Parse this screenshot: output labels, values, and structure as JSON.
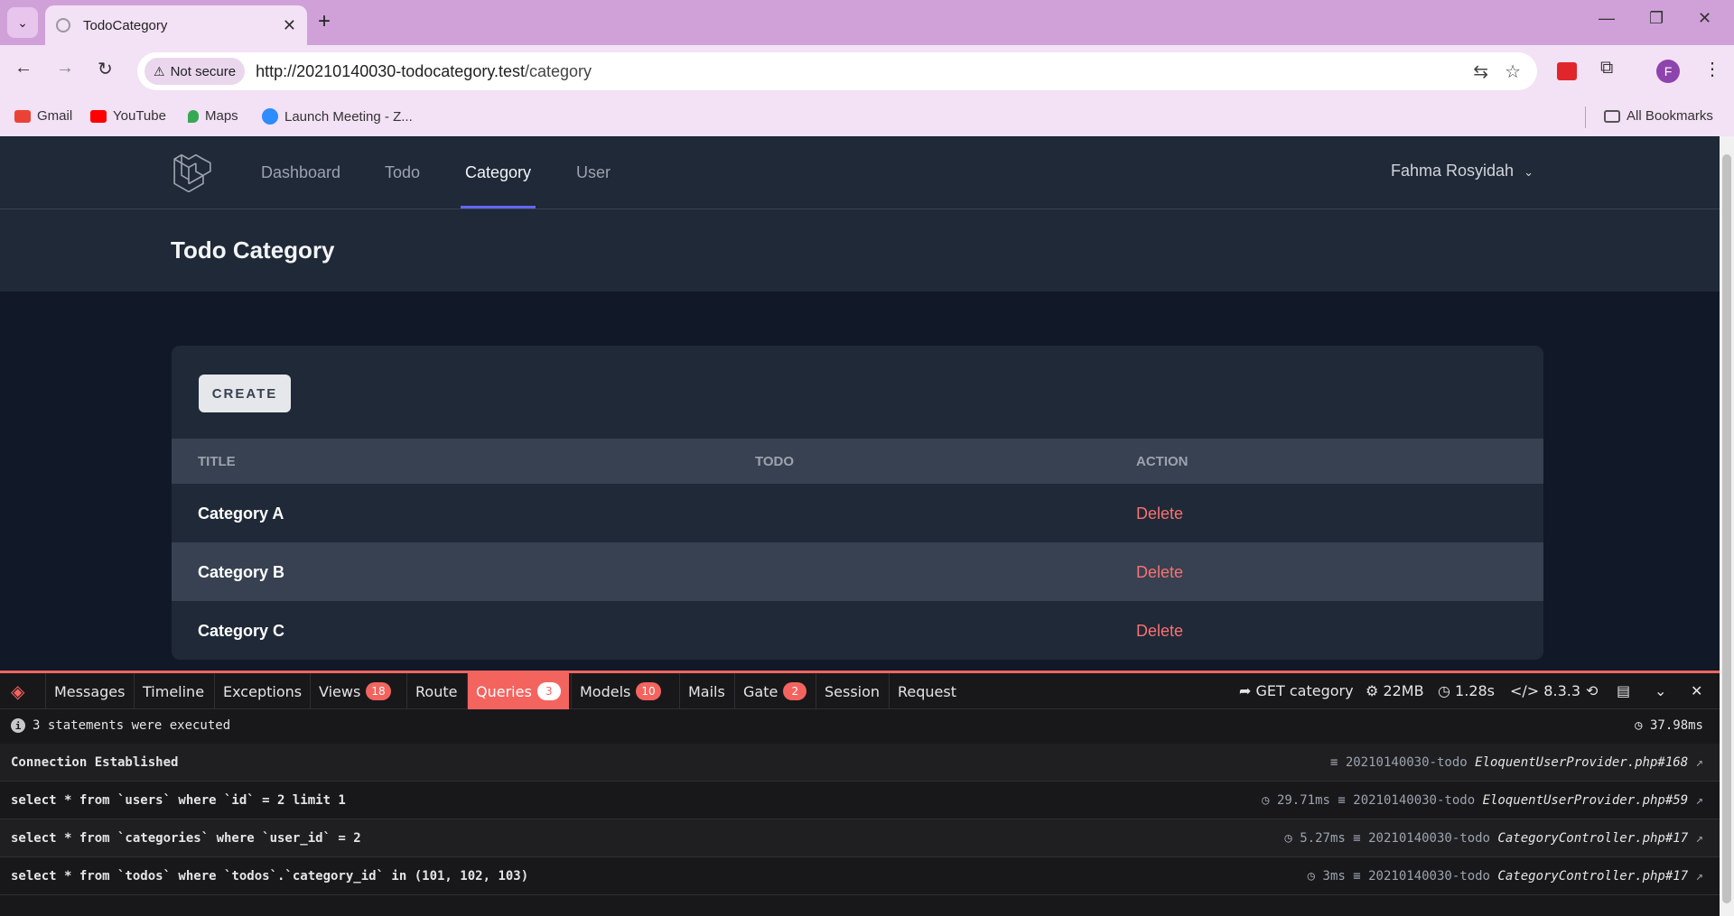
{
  "browser": {
    "tab_title": "TodoCategory",
    "security_label": "Not secure",
    "url_host": "http://20210140030-todocategory.test",
    "url_path": "/category",
    "profile_initial": "F",
    "bookmarks": [
      "Gmail",
      "YouTube",
      "Maps",
      "Launch Meeting - Z..."
    ],
    "all_bookmarks_label": "All Bookmarks"
  },
  "app": {
    "nav": [
      "Dashboard",
      "Todo",
      "Category",
      "User"
    ],
    "active_nav": "Category",
    "user_name": "Fahma Rosyidah",
    "page_title": "Todo Category",
    "create_label": "CREATE",
    "table": {
      "headers": [
        "TITLE",
        "TODO",
        "ACTION"
      ],
      "rows": [
        {
          "title": "Category A",
          "todo": "",
          "action": "Delete"
        },
        {
          "title": "Category B",
          "todo": "",
          "action": "Delete"
        },
        {
          "title": "Category C",
          "todo": "",
          "action": "Delete"
        }
      ]
    }
  },
  "debugbar": {
    "tabs": [
      {
        "label": "Messages",
        "badge": ""
      },
      {
        "label": "Timeline",
        "badge": ""
      },
      {
        "label": "Exceptions",
        "badge": ""
      },
      {
        "label": "Views",
        "badge": "18"
      },
      {
        "label": "Route",
        "badge": ""
      },
      {
        "label": "Queries",
        "badge": "3"
      },
      {
        "label": "Models",
        "badge": "10"
      },
      {
        "label": "Mails",
        "badge": ""
      },
      {
        "label": "Gate",
        "badge": "2"
      },
      {
        "label": "Session",
        "badge": ""
      },
      {
        "label": "Request",
        "badge": ""
      }
    ],
    "active_tab": "Queries",
    "route": "GET category",
    "memory": "22MB",
    "duration": "1.28s",
    "php_version": "8.3.3",
    "summary": "3 statements were executed",
    "total_time": "37.98ms",
    "queries": [
      {
        "sql": "Connection Established",
        "time": "",
        "db": "20210140030-todo",
        "file": "EloquentUserProvider.php#168"
      },
      {
        "sql": "select * from `users` where `id` = 2 limit 1",
        "time": "29.71ms",
        "db": "20210140030-todo",
        "file": "EloquentUserProvider.php#59"
      },
      {
        "sql": "select * from `categories` where `user_id` = 2",
        "time": "5.27ms",
        "db": "20210140030-todo",
        "file": "CategoryController.php#17"
      },
      {
        "sql": "select * from `todos` where `todos`.`category_id` in (101, 102, 103)",
        "time": "3ms",
        "db": "20210140030-todo",
        "file": "CategoryController.php#17"
      }
    ]
  }
}
